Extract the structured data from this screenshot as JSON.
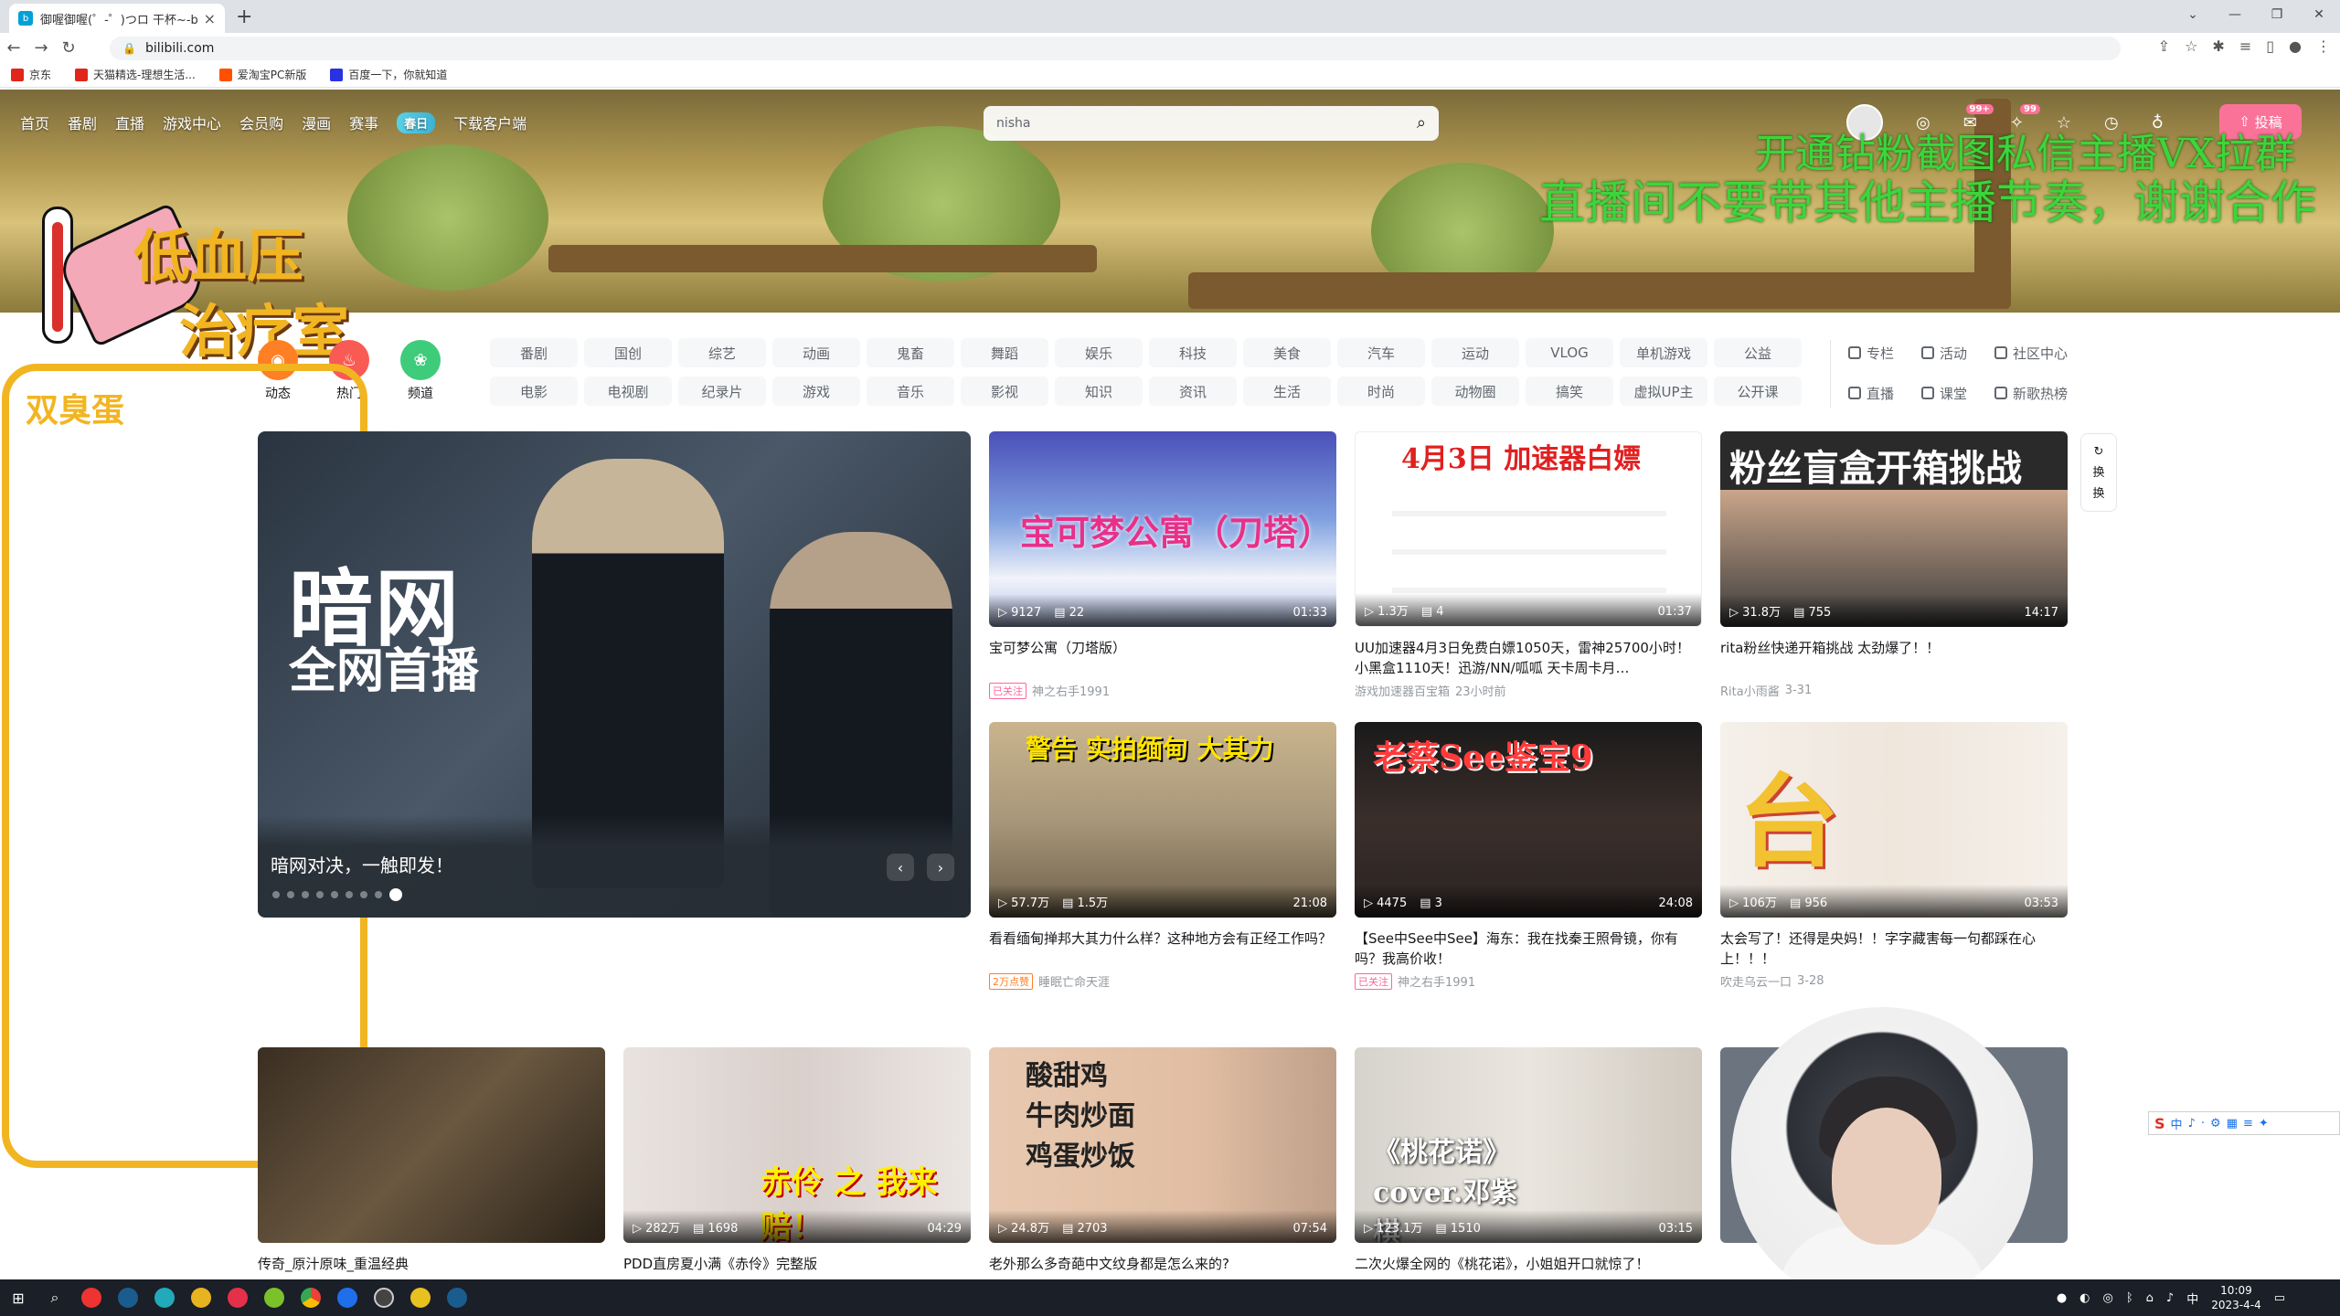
{
  "browser": {
    "tab_title": "御喔御喔(゜-゜)つロ 干杯~-bili",
    "url": "bilibili.com",
    "bookmarks": [
      {
        "label": "京东",
        "color": "#e1251b"
      },
      {
        "label": "天猫精选-理想生活...",
        "color": "#e1251b"
      },
      {
        "label": "爱淘宝PC新版",
        "color": "#ff5000"
      },
      {
        "label": "百度一下，你就知道",
        "color": "#2932e1"
      }
    ]
  },
  "header": {
    "nav": [
      "首页",
      "番剧",
      "直播",
      "游戏中心",
      "会员购",
      "漫画",
      "赛事"
    ],
    "nav_special": "春日",
    "download": "下载客户端",
    "search_value": "nisha",
    "upload_label": "投稿",
    "badge_msg": "99+",
    "badge_dyn": "99"
  },
  "overlays": {
    "line1": "开通钻粉截图私信主播VX拉群",
    "line2": "直播间不要带其他主播节奏，谢谢合作",
    "logo_line1": "低血压",
    "logo_line2": "治疗室",
    "left_label": "双臭蛋"
  },
  "channels": [
    {
      "label": "动态",
      "color": "#ff7f24"
    },
    {
      "label": "热门",
      "color": "#f85a54"
    },
    {
      "label": "频道",
      "color": "#3ecc7b"
    }
  ],
  "categories": [
    "番剧",
    "国创",
    "综艺",
    "动画",
    "鬼畜",
    "舞蹈",
    "娱乐",
    "科技",
    "美食",
    "汽车",
    "运动",
    "VLOG",
    "单机游戏",
    "公益",
    "电影",
    "电视剧",
    "纪录片",
    "游戏",
    "音乐",
    "影视",
    "知识",
    "资讯",
    "生活",
    "时尚",
    "动物圈",
    "搞笑",
    "虚拟UP主",
    "公开课"
  ],
  "side_links": [
    "专栏",
    "活动",
    "社区中心",
    "直播",
    "课堂",
    "新歌热榜"
  ],
  "carousel": {
    "big1": "暗网",
    "big2": "全网首播",
    "title": "暗网对决，一触即发！"
  },
  "refresh": [
    "换",
    "一",
    "换"
  ],
  "cards": [
    {
      "title": "宝可梦公寓（刀塔版）",
      "views": "9127",
      "danmaku": "22",
      "duration": "01:33",
      "tag": "已关注",
      "author": "神之右手1991",
      "date": "",
      "thumb": "宝可梦公寓（刀塔）"
    },
    {
      "title": "UU加速器4月3日免费白嫖1050天，雷神25700小时！小黑盒1110天！迅游/NN/呱呱 天卡周卡月…",
      "views": "1.3万",
      "danmaku": "4",
      "duration": "01:37",
      "tag": "",
      "author": "游戏加速器百宝箱",
      "date": "23小时前",
      "thumb": "4月3日 加速器白嫖"
    },
    {
      "title": "rita粉丝快递开箱挑战 太劲爆了！！",
      "views": "31.8万",
      "danmaku": "755",
      "duration": "14:17",
      "tag": "",
      "author": "Rita小雨酱",
      "date": "3-31",
      "thumb": "粉丝盲盒开箱挑战"
    },
    {
      "title": "看看缅甸掸邦大其力什么样？这种地方会有正经工作吗？",
      "views": "57.7万",
      "danmaku": "1.5万",
      "duration": "21:08",
      "tag": "2万点赞",
      "author": "睡眠亡命天涯",
      "date": "",
      "thumb": "警告 实拍缅甸 大其力"
    },
    {
      "title": "【See中See中See】海东：我在找秦王照骨镜，你有吗？我高价收！",
      "views": "4475",
      "danmaku": "3",
      "duration": "24:08",
      "tag": "已关注",
      "author": "神之右手1991",
      "date": "",
      "thumb": "老蔡See鉴宝9"
    },
    {
      "title": "太会写了！还得是央妈！！字字藏害每一句都踩在心上！！！",
      "views": "106万",
      "danmaku": "956",
      "duration": "03:53",
      "tag": "",
      "author": "吹走乌云一口",
      "date": "3-28",
      "thumb": "台词"
    },
    {
      "title": "传奇_原汁原味_重温经典",
      "views": "",
      "danmaku": "",
      "duration": "",
      "tag": "",
      "author": "",
      "date": "",
      "thumb": ""
    },
    {
      "title": "PDD直房夏小满《赤伶》完整版",
      "views": "282万",
      "danmaku": "1698",
      "duration": "04:29",
      "tag": "",
      "author": "",
      "date": "",
      "thumb": "赤伶 之 我来赔！"
    },
    {
      "title": "老外那么多奇葩中文纹身都是怎么来的?",
      "views": "24.8万",
      "danmaku": "2703",
      "duration": "07:54",
      "tag": "",
      "author": "",
      "date": "",
      "thumb": "酸甜鸡 牛肉炒面 鸡蛋炒饭"
    },
    {
      "title": "二次火爆全网的《桃花诺》，小姐姐开口就惊了！",
      "views": "123.1万",
      "danmaku": "1510",
      "duration": "03:15",
      "tag": "",
      "author": "",
      "date": "",
      "thumb": "《桃花诺》 cover.邓紫棋"
    }
  ],
  "taskbar": {
    "time": "10:09",
    "date": "2023-4-4"
  },
  "ime": [
    "中",
    "♪",
    "·",
    "⚙",
    "▦",
    "≡",
    "✦"
  ]
}
